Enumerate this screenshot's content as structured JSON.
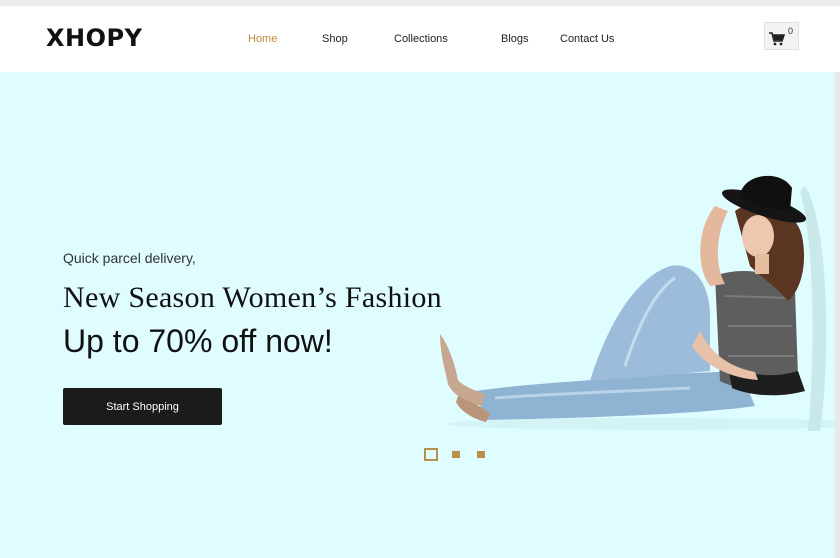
{
  "brand": {
    "logo": "XHOPY"
  },
  "nav": {
    "items": [
      {
        "label": "Home",
        "active": true
      },
      {
        "label": "Shop"
      },
      {
        "label": "Collections"
      },
      {
        "label": "Blogs"
      },
      {
        "label": "Contact Us"
      }
    ]
  },
  "cart": {
    "count": "0",
    "icon": "cart-icon"
  },
  "hero": {
    "tagline": "Quick parcel delivery,",
    "headline": "New Season Women’s Fashion",
    "subheadline": "Up to 70% off now!",
    "cta_label": "Start Shopping",
    "image": "woman-in-hat-and-jeans-sitting",
    "background_color": "#dffdff",
    "slider": {
      "total": 3,
      "active_index": 0
    }
  },
  "colors": {
    "accent": "#c08a3a",
    "dark": "#1b1b1b"
  }
}
